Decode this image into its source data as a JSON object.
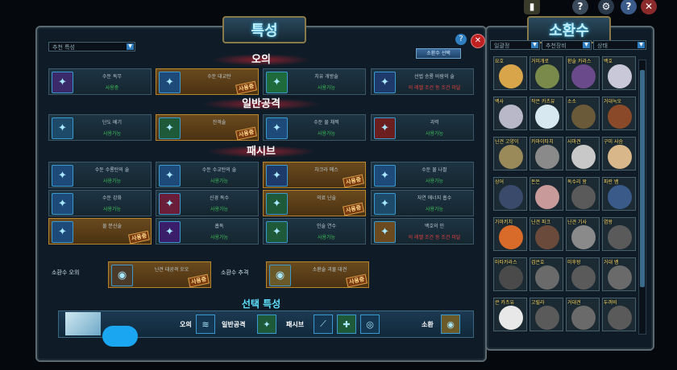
{
  "main": {
    "title": "특성",
    "filter_select": "추천 특성",
    "reset_button": "소환수 선택",
    "sections": {
      "attack": "오의",
      "normal": "일반공격",
      "passive": "패시브"
    },
    "badge_text": "사용중",
    "attack_traits": [
      {
        "name": "수둔 독무",
        "state": "사용중",
        "active": false,
        "icon": "fog-icon",
        "color": "#3a2a6a"
      },
      {
        "name": "수둔 대교탄",
        "state": "",
        "active": true,
        "icon": "water-shark-icon",
        "color": "#1e4a7a"
      },
      {
        "name": "치유 개방술",
        "state": "사용가능",
        "active": false,
        "icon": "heal-leaf-icon",
        "color": "#1e6a3a"
      },
      {
        "name": "선법 승룡 바람의 술",
        "state": "의 레벨 조건 등 조건 미달",
        "active": false,
        "icon": "sage-icon",
        "color": "#1e3a6a",
        "red": true
      }
    ],
    "normal_traits": [
      {
        "name": "단도 베기",
        "state": "사용가능",
        "active": false,
        "icon": "kunai-icon",
        "color": "#1e4a6a"
      },
      {
        "name": "잔격술",
        "state": "",
        "active": true,
        "icon": "slash-icon",
        "color": "#1e5a3a"
      },
      {
        "name": "수둔 물 채찍",
        "state": "사용가능",
        "active": false,
        "icon": "water-whip-icon",
        "color": "#1e4a7a"
      },
      {
        "name": "괴력",
        "state": "사용가능",
        "active": false,
        "icon": "fist-icon",
        "color": "#6a1e1e"
      }
    ],
    "passive_traits": [
      {
        "name": "수둔 수룡탄의 술",
        "state": "사용가능",
        "active": false,
        "icon": "water-dragon-icon",
        "color": "#1e4a7a"
      },
      {
        "name": "수둔 수교탄의 술",
        "state": "사용가능",
        "active": false,
        "icon": "water-shark-icon",
        "color": "#1e4a7a"
      },
      {
        "name": "차크라 메스",
        "state": "",
        "active": true,
        "icon": "chakra-blade-icon",
        "color": "#1e3a6a"
      },
      {
        "name": "수둔 물 나팔",
        "state": "사용가능",
        "active": false,
        "icon": "water-spout-icon",
        "color": "#1e4a7a"
      },
      {
        "name": "수둔 강화",
        "state": "사용가능",
        "active": false,
        "icon": "water-glyph-icon",
        "color": "#1e4a7a"
      },
      {
        "name": "신경 독수",
        "state": "사용가능",
        "active": false,
        "icon": "nerve-icon",
        "color": "#6a1e3a"
      },
      {
        "name": "의료 닌술",
        "state": "",
        "active": true,
        "icon": "medical-icon",
        "color": "#1e5a3a"
      },
      {
        "name": "자연 에너지 흡수",
        "state": "사용가능",
        "active": false,
        "icon": "nature-icon",
        "color": "#1e4a6a"
      },
      {
        "name": "물 분신술",
        "state": "",
        "active": true,
        "icon": "clone-icon",
        "color": "#1e4a7a"
      },
      {
        "name": "흡독",
        "state": "사용가능",
        "active": false,
        "icon": "poison-icon",
        "color": "#3a1e6a"
      },
      {
        "name": "인술 연수",
        "state": "사용가능",
        "active": false,
        "icon": "ninja-icon",
        "color": "#1e5a3a"
      },
      {
        "name": "백호의 인",
        "state": "의 레벨 조건 등 조건 미달",
        "active": false,
        "icon": "seal-icon",
        "color": "#6a4a1e",
        "red": true
      }
    ],
    "summon_row": {
      "label1": "소환수 오의",
      "trait1": "닌견 대공격 오오",
      "label2": "소환수 추격",
      "trait2": "소환술 괴물 대견"
    },
    "selected": {
      "title": "선택 특성",
      "attack": "오의",
      "normal": "일반공격",
      "passive": "패시브",
      "summon": "소환"
    }
  },
  "summon_panel": {
    "title": "소환수",
    "filters": [
      "일괄정",
      "추천장비",
      "상태"
    ],
    "cells": [
      {
        "name": "요호",
        "color": "#d9a54a"
      },
      {
        "name": "거미개로",
        "color": "#7a8a4a"
      },
      {
        "name": "환술 카라스",
        "color": "#6a4a8a"
      },
      {
        "name": "백호",
        "color": "#c8c8d8"
      },
      {
        "name": "백사",
        "color": "#b8b8c8"
      },
      {
        "name": "작은 카츠유",
        "color": "#d8e8f0"
      },
      {
        "name": "소소",
        "color": "#6a5a3a"
      },
      {
        "name": "거대늑오",
        "color": "#8a4a2a"
      },
      {
        "name": "닌견 고양이",
        "color": "#9a8a5a"
      },
      {
        "name": "카마이타치",
        "color": "#8a8a8a"
      },
      {
        "name": "사마견",
        "color": "#c8c8c8"
      },
      {
        "name": "구미 사슴",
        "color": "#d8b88a"
      },
      {
        "name": "상어",
        "color": "#3a4a6a"
      },
      {
        "name": "돈돈",
        "color": "#c89a9a"
      },
      {
        "name": "독수리 왕",
        "color": "#5a5a5a"
      },
      {
        "name": "파란 뱀",
        "color": "#3a5a8a"
      },
      {
        "name": "가마키치",
        "color": "#d86a2a"
      },
      {
        "name": "닌견 파크",
        "color": "#6a4a3a"
      },
      {
        "name": "닌견 기사",
        "color": "#8a8a8a"
      },
      {
        "name": "염왕",
        "color": "#5a5a5a"
      },
      {
        "name": "마타카라스",
        "color": "#4a4a4a"
      },
      {
        "name": "검은호",
        "color": "#6a6a6a"
      },
      {
        "name": "미후왕",
        "color": "#5a5a5a"
      },
      {
        "name": "거대 뱀",
        "color": "#6a6a6a"
      },
      {
        "name": "큰 카츠유",
        "color": "#e8e8e8"
      },
      {
        "name": "고릴라",
        "color": "#5a5a5a"
      },
      {
        "name": "거대견",
        "color": "#6a6a6a"
      },
      {
        "name": "두꺼비",
        "color": "#5a5a5a"
      }
    ]
  }
}
